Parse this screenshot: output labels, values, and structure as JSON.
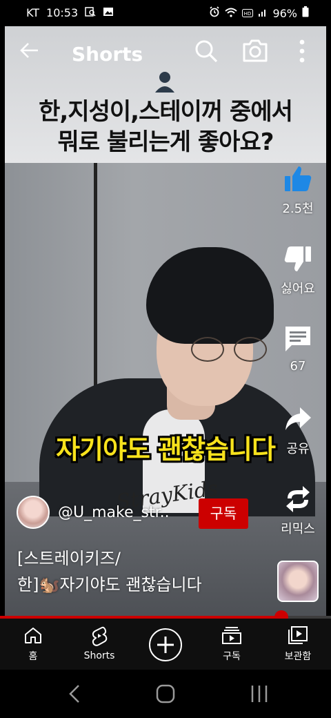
{
  "status_bar": {
    "carrier": "KT",
    "time": "10:53",
    "battery": "96%",
    "icons_left": [
      "search-doc-icon",
      "gallery-icon"
    ],
    "icons_right": [
      "alarm-icon",
      "wifi-icon",
      "hd-icon",
      "signal-icon",
      "battery-icon"
    ]
  },
  "top_bar": {
    "title": "Shorts",
    "back_icon": "back-arrow-icon",
    "search_icon": "search-icon",
    "camera_icon": "camera-icon",
    "more_icon": "more-vert-icon"
  },
  "video": {
    "title_line_1": "한,지성이,스테이꺼 중에서",
    "title_line_2": "뭐로 불리는게 좋아요?",
    "subtitle": "자기야도 괜찮습니다",
    "signature": "StrayKids"
  },
  "actions": {
    "like_count": "2.5천",
    "dislike_label": "싫어요",
    "comment_count": "67",
    "share_label": "공유",
    "remix_label": "리믹스"
  },
  "channel": {
    "handle": "@U_make_str..",
    "subscribe_label": "구독"
  },
  "caption": {
    "line_1": "[스트레이키즈/",
    "line_2": "한]🐿️자기야도 괜찮습니다"
  },
  "progress": {
    "fraction": 0.85,
    "color": "#cc0000"
  },
  "bottom_nav": {
    "home": "홈",
    "shorts": "Shorts",
    "subscriptions": "구독",
    "library": "보관함"
  },
  "colors": {
    "accent_red": "#cc0000",
    "subtitle_yellow": "#f7e21c"
  }
}
